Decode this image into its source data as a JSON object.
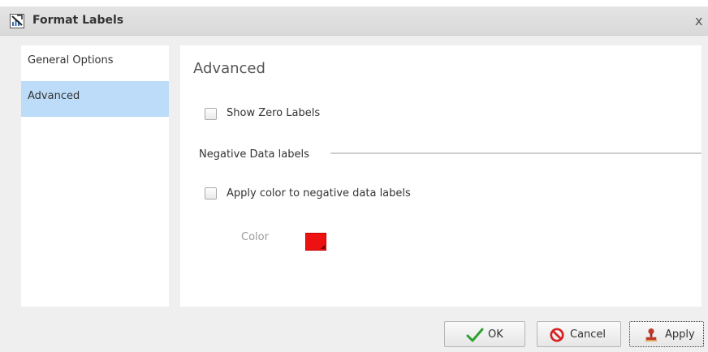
{
  "dialog": {
    "title": "Format Labels",
    "close_glyph": "x",
    "title_icon": "chart-label-icon",
    "close_icon": "close-icon"
  },
  "sidebar": {
    "items": [
      {
        "label": "General Options",
        "selected": false
      },
      {
        "label": "Advanced",
        "selected": true
      }
    ],
    "selected_color": "#bcdcf9"
  },
  "panel": {
    "title": "Advanced",
    "show_zero_labels": {
      "label": "Show Zero Labels",
      "checked": false
    },
    "negative_section": {
      "label": "Negative Data labels"
    },
    "apply_color": {
      "label": "Apply color to negative data labels",
      "checked": false
    },
    "color": {
      "label": "Color",
      "value": "#ee1111"
    }
  },
  "buttons": {
    "ok": {
      "label": "OK",
      "icon": "checkmark-icon"
    },
    "cancel": {
      "label": "Cancel",
      "icon": "cancel-icon"
    },
    "apply": {
      "label": "Apply",
      "icon": "stamp-icon"
    }
  }
}
